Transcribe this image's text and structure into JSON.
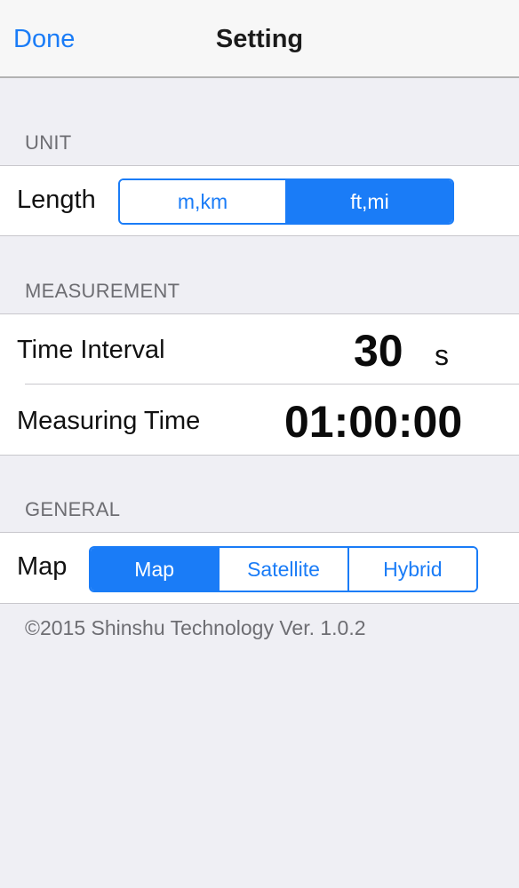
{
  "nav": {
    "done_label": "Done",
    "title": "Setting"
  },
  "unit": {
    "header": "UNIT",
    "length_label": "Length",
    "options": [
      "m,km",
      "ft,mi"
    ],
    "selected": "ft,mi"
  },
  "measurement": {
    "header": "MEASUREMENT",
    "interval_label": "Time Interval",
    "interval_value": "30",
    "interval_unit": "s",
    "measuring_label": "Measuring Time",
    "measuring_value": "01:00:00"
  },
  "general": {
    "header": "GENERAL",
    "map_label": "Map",
    "options": [
      "Map",
      "Satellite",
      "Hybrid"
    ],
    "selected": "Map"
  },
  "footer": {
    "text": "©2015 Shinshu Technology Ver. 1.0.2"
  },
  "colors": {
    "accent": "#1a7cf7",
    "background": "#efeff4"
  }
}
